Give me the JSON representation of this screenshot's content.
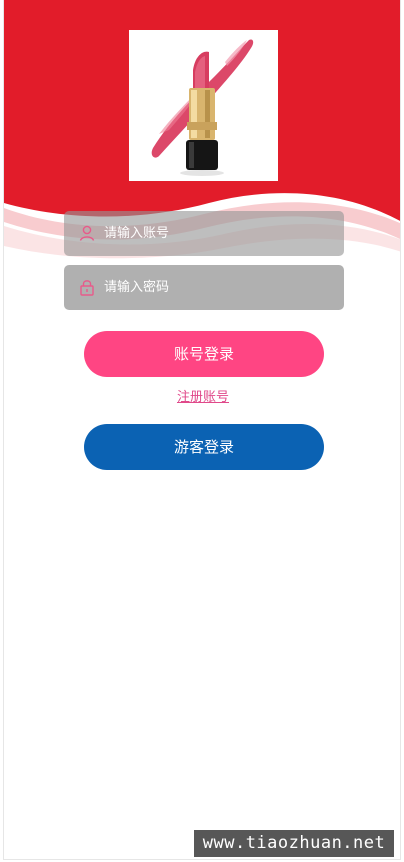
{
  "colors": {
    "header_red": "#e21c2a",
    "login_button": "#ff4583",
    "guest_button": "#0b62b3",
    "register_link": "#e0498a",
    "field_gray": "#b0b0b0"
  },
  "hero": {
    "image_icon": "lipstick-product-image"
  },
  "form": {
    "account": {
      "icon": "user-icon",
      "placeholder": "请输入账号"
    },
    "password": {
      "icon": "lock-icon",
      "placeholder": "请输入密码"
    },
    "login_button_label": "账号登录",
    "register_link_label": "注册账号",
    "guest_button_label": "游客登录"
  },
  "watermark": {
    "text": "www.tiaozhuan.net"
  }
}
